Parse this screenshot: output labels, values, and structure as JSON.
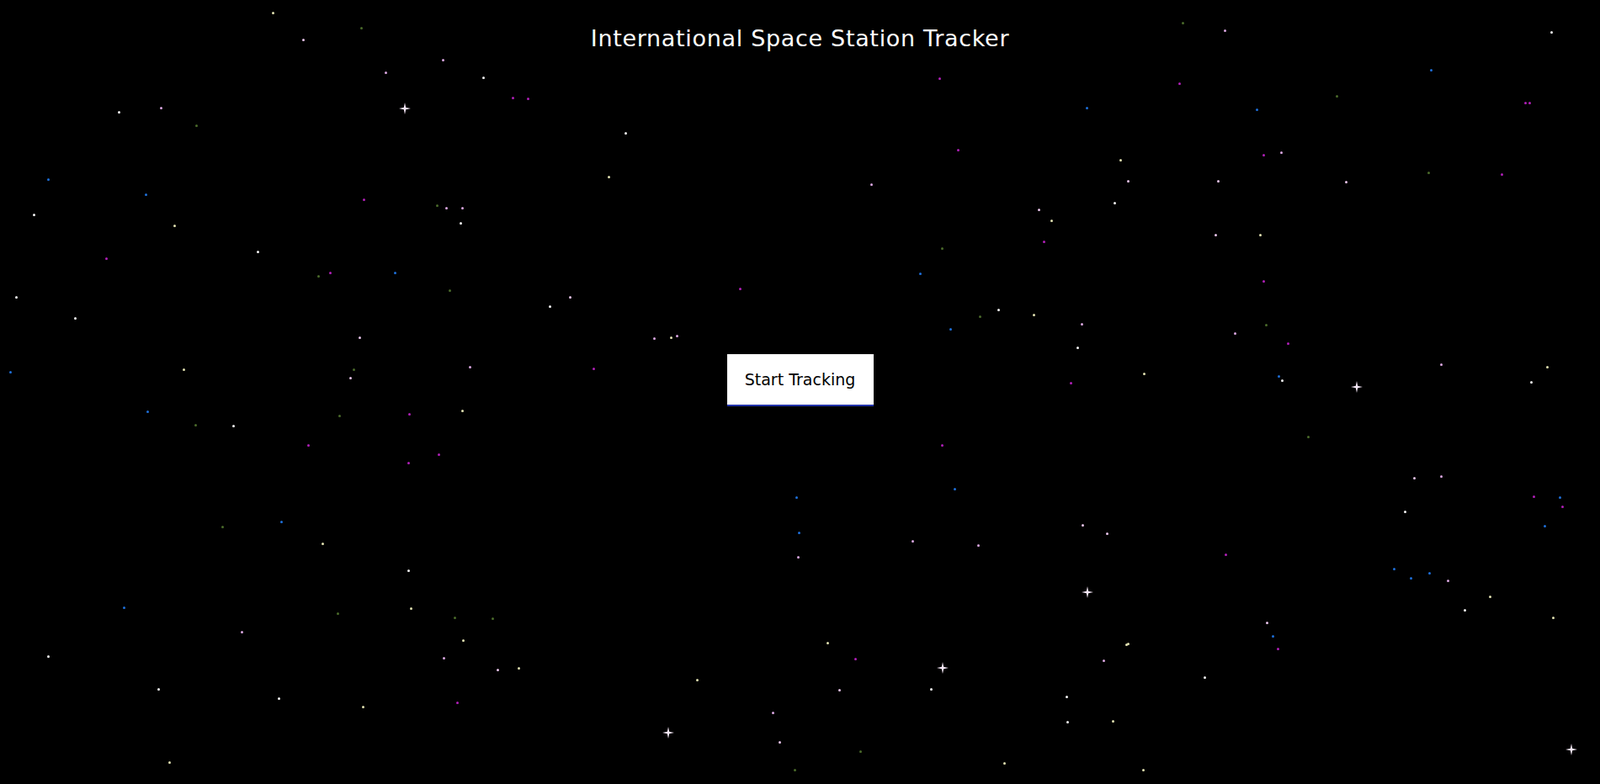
{
  "window": {
    "title": "International Space Station Tracker"
  },
  "button": {
    "label": "Start Tracking"
  }
}
